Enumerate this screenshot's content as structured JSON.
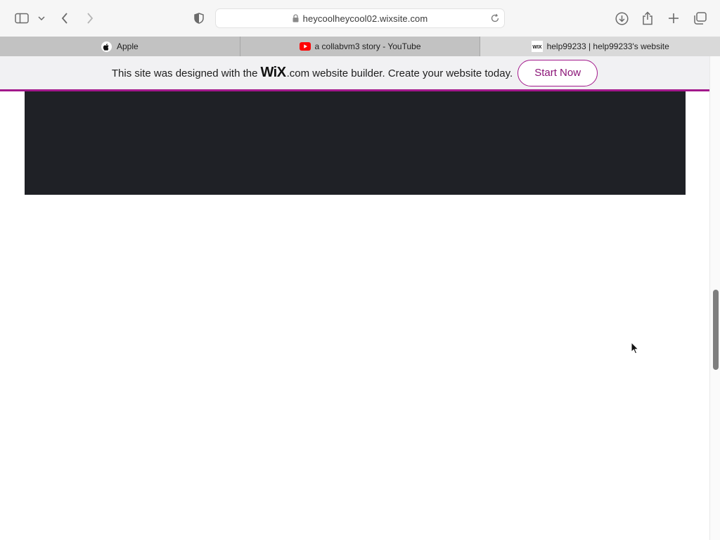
{
  "browser": {
    "url": "heycoolheycool02.wixsite.com",
    "icons": {
      "sidebar": "sidebar-icon",
      "back": "chevron-left-icon",
      "forward": "chevron-right-icon",
      "privacy": "shield-icon",
      "download": "download-icon",
      "share": "share-icon",
      "new_tab": "plus-icon",
      "tabs_overview": "tabs-overview-icon"
    }
  },
  "tabs": [
    {
      "label": "Apple",
      "favicon": "apple-icon",
      "active": false
    },
    {
      "label": "a collabvm3 story - YouTube",
      "favicon": "youtube-icon",
      "active": false
    },
    {
      "label": "help99233 | help99233's website",
      "favicon": "wix-icon",
      "active": true
    }
  ],
  "wix_banner": {
    "text_before": "This site was designed with the",
    "logo": "WiX",
    "text_after": ".com website builder. Create your website today.",
    "button_label": "Start Now",
    "accent_color": "#a3198c"
  },
  "page": {
    "block_color": "#1f2126"
  }
}
